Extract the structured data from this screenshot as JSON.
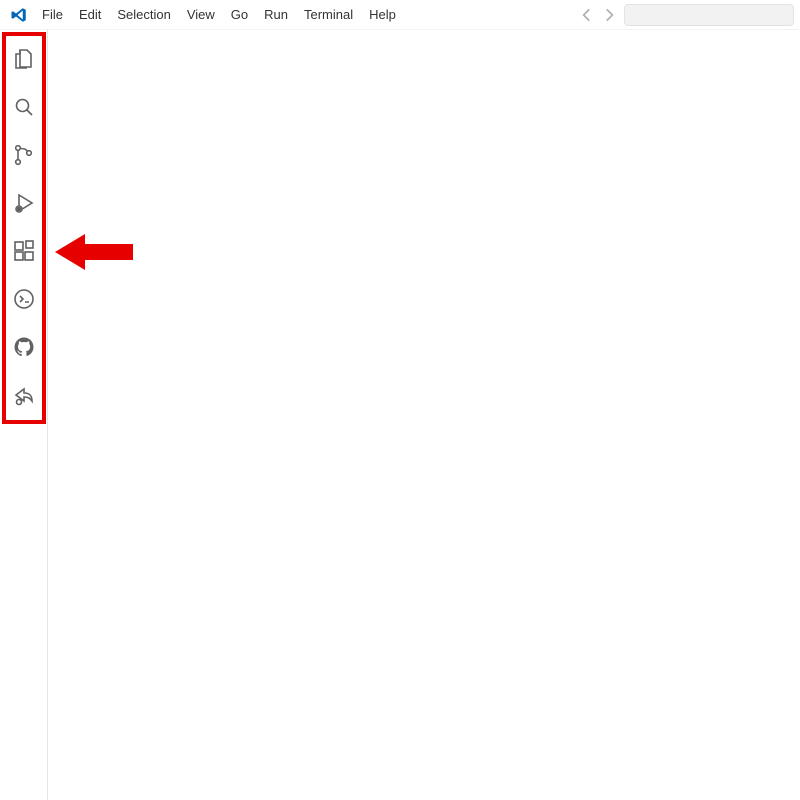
{
  "menu": {
    "items": [
      "File",
      "Edit",
      "Selection",
      "View",
      "Go",
      "Run",
      "Terminal",
      "Help"
    ]
  },
  "search": {
    "placeholder": ""
  },
  "activity_bar": {
    "items": [
      {
        "name": "explorer",
        "icon": "files-icon"
      },
      {
        "name": "search",
        "icon": "search-icon"
      },
      {
        "name": "source-control",
        "icon": "source-control-icon"
      },
      {
        "name": "run-debug",
        "icon": "debug-icon"
      },
      {
        "name": "extensions",
        "icon": "extensions-icon"
      },
      {
        "name": "remote-explorer",
        "icon": "remote-icon"
      },
      {
        "name": "github",
        "icon": "github-icon"
      },
      {
        "name": "live-share",
        "icon": "live-share-icon"
      }
    ]
  },
  "annotation": {
    "highlight_target": "activity-bar",
    "arrow_target": "extensions",
    "color": "#e60000"
  }
}
